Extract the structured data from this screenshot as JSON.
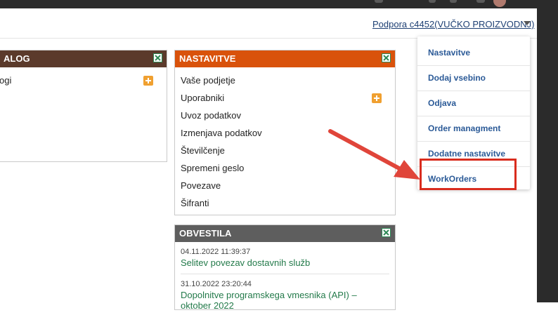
{
  "header": {
    "user_menu_label": "Podpora c4452(VUČKO PROIZVODNJ)"
  },
  "left_panel": {
    "title": "ALOG",
    "items": [
      "ogi"
    ]
  },
  "settings_panel": {
    "title": "NASTAVITVE",
    "items": [
      "Vaše podjetje",
      "Uporabniki",
      "Uvoz podatkov",
      "Izmenjava podatkov",
      "Številčenje",
      "Spremeni geslo",
      "Povezave",
      "Šifranti"
    ]
  },
  "news_panel": {
    "title": "OBVESTILA",
    "entries": [
      {
        "date": "04.11.2022 11:39:37",
        "title": "Selitev povezav dostavnih služb"
      },
      {
        "date": "31.10.2022 23:20:44",
        "title": "Dopolnitve programskega vmesnika (API) –",
        "title_cont": "oktober 2022"
      }
    ]
  },
  "dropdown": {
    "items": [
      "Nastavitve",
      "Dodaj vsebino",
      "Odjava",
      "Order managment",
      "Dodatne nastavitve",
      "WorkOrders"
    ]
  },
  "colors": {
    "settings_header": "#d9520b",
    "left_header": "#5b3a2b",
    "news_header": "#5e5e5e",
    "link_blue": "#2b5a97",
    "news_green": "#237a4a",
    "annotation_red": "#d92c1e"
  }
}
